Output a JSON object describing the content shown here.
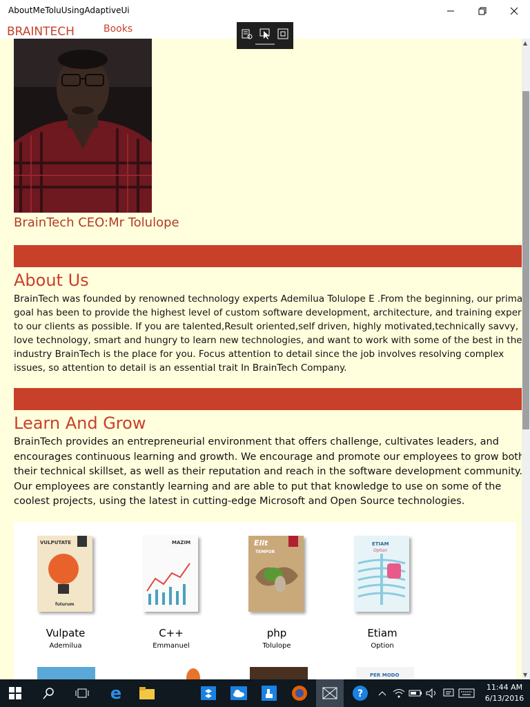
{
  "window": {
    "title": "AboutMeToluUsingAdaptiveUi"
  },
  "nav": {
    "brand": "BRAINTECH",
    "books": "Books"
  },
  "profile": {
    "caption": "BrainTech CEO:Mr Tolulope"
  },
  "about": {
    "heading": "About Us",
    "text": "BrainTech was founded by renowned technology experts Ademilua Tolulope E .From the beginning, our primary goal has been to provide the highest level of custom software development, architecture, and training expertise to our clients as possible. If you are talented,Result oriented,self driven, highly motivated,technically savvy, love technology, smart and hungry to learn new technologies, and want to work with some of the best in the industry BrainTech is the place for you. Focus attention to detail since the job involves resolving complex issues, so attention to detail is an essential trait In BrainTech Company."
  },
  "learn": {
    "heading": "Learn And Grow",
    "text": "BrainTech provides an entrepreneurial environment that offers challenge, cultivates leaders, and encourages continuous learning and growth. We encourage and promote our employees to grow both their technical skillset, as well as their reputation and reach in the software development community. Our employees are constantly learning and are able to put that knowledge to use on some of the coolest projects, using the latest in cutting-edge Microsoft and Open Source technologies."
  },
  "books": [
    {
      "title": "Vulpate",
      "author": "Ademilua",
      "cover_text": "VULPUTATE",
      "cover_sub": "futurum",
      "color": "#f3e5c8"
    },
    {
      "title": "C++",
      "author": "Emmanuel",
      "cover_text": "MAZIM",
      "color": "#ffffff"
    },
    {
      "title": "php",
      "author": "Tolulope",
      "cover_text": "Elit",
      "cover_sub": "TEMPOR",
      "color": "#c9a87a"
    },
    {
      "title": "Etiam",
      "author": "Option",
      "cover_text": "ETIAM",
      "cover_sub": "Option",
      "color": "#eaf4f7"
    }
  ],
  "bottom_covers": {
    "per_modo": "PER MODO"
  },
  "clock": {
    "time": "11:44 AM",
    "date": "6/13/2016"
  },
  "icons": {
    "start": "windows-start-icon",
    "search": "search-icon",
    "task_view": "task-view-icon",
    "edge": "edge-browser-icon",
    "explorer": "file-explorer-icon"
  },
  "colors": {
    "accent": "#c8402a",
    "content_bg": "#fffedd",
    "taskbar": "#101820"
  }
}
